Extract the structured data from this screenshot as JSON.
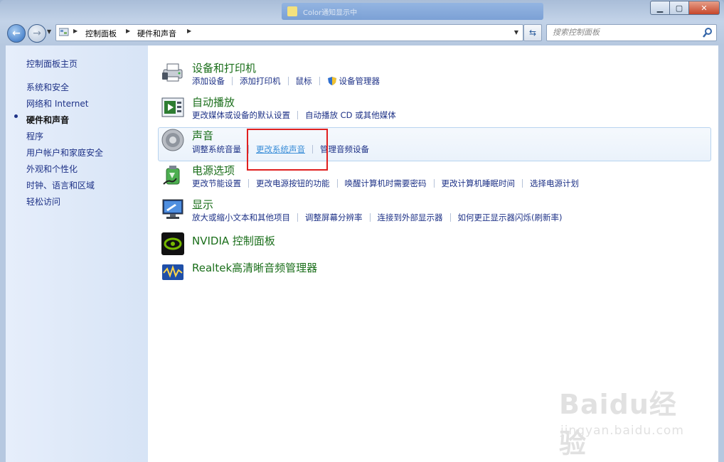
{
  "window": {
    "behind_title": "Color通知显示中"
  },
  "nav": {
    "breadcrumb": [
      "控制面板",
      "硬件和声音"
    ],
    "search_placeholder": "搜索控制面板"
  },
  "sidebar": {
    "home": "控制面板主页",
    "items": [
      {
        "label": "系统和安全"
      },
      {
        "label": "网络和 Internet"
      },
      {
        "label": "硬件和声音"
      },
      {
        "label": "程序"
      },
      {
        "label": "用户帐户和家庭安全"
      },
      {
        "label": "外观和个性化"
      },
      {
        "label": "时钟、语言和区域"
      },
      {
        "label": "轻松访问"
      }
    ]
  },
  "categories": [
    {
      "title": "设备和打印机",
      "icon": "printer-icon",
      "links": [
        "添加设备",
        "添加打印机",
        "鼠标",
        "设备管理器"
      ]
    },
    {
      "title": "自动播放",
      "icon": "autoplay-icon",
      "links": [
        "更改媒体或设备的默认设置",
        "自动播放 CD 或其他媒体"
      ]
    },
    {
      "title": "声音",
      "icon": "speaker-icon",
      "links": [
        "调整系统音量",
        "更改系统声音",
        "管理音频设备"
      ]
    },
    {
      "title": "电源选项",
      "icon": "power-icon",
      "links": [
        "更改节能设置",
        "更改电源按钮的功能",
        "唤醒计算机时需要密码",
        "更改计算机睡眠时间",
        "选择电源计划"
      ]
    },
    {
      "title": "显示",
      "icon": "display-icon",
      "links": [
        "放大或缩小文本和其他项目",
        "调整屏幕分辨率",
        "连接到外部显示器",
        "如何更正显示器闪烁(刷新率)"
      ]
    },
    {
      "title": "NVIDIA 控制面板",
      "icon": "nvidia-icon",
      "links": []
    },
    {
      "title": "Realtek高清晰音频管理器",
      "icon": "realtek-icon",
      "links": []
    }
  ],
  "watermark": {
    "logo": "Baidu经验",
    "url": "jingyan.baidu.com"
  },
  "colors": {
    "link": "#1e3287",
    "category_title": "#1a6e1a",
    "highlight_border": "#e02020"
  }
}
